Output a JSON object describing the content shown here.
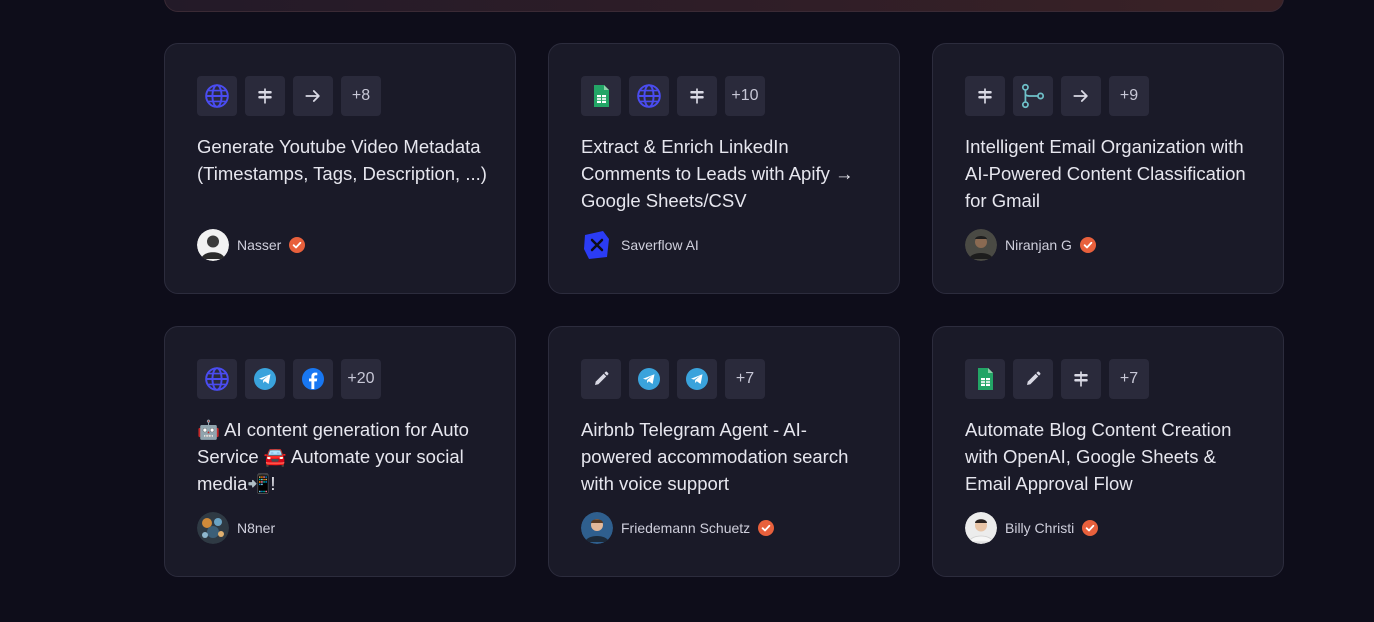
{
  "cards": [
    {
      "title": "Generate Youtube Video Metadata (Timestamps, Tags, Description, ...)",
      "more": "+8",
      "author": "Nasser",
      "verified": true
    },
    {
      "title": "Extract & Enrich LinkedIn Comments to Leads with Apify → Google Sheets/CSV",
      "more": "+10",
      "author": "Saverflow AI",
      "verified": false
    },
    {
      "title": "Intelligent Email Organization with AI-Powered Content Classification for Gmail",
      "more": "+9",
      "author": "Niranjan G",
      "verified": true
    },
    {
      "title": "🤖 AI content generation for Auto Service 🚘 Automate your social media📲!",
      "more": "+20",
      "author": "N8ner",
      "verified": false
    },
    {
      "title": "Airbnb Telegram Agent - AI-powered accommodation search with voice support",
      "more": "+7",
      "author": "Friedemann Schuetz",
      "verified": true
    },
    {
      "title": "Automate Blog Content Creation with OpenAI, Google Sheets & Email Approval Flow",
      "more": "+7",
      "author": "Billy Christi",
      "verified": true
    }
  ],
  "colors": {
    "background": "#0e0d1a",
    "card": "#1a1a28",
    "tile": "#2a2a3b",
    "verified": "#e8603c",
    "globe": "#4a4cf0",
    "telegram": "#3aa3dc",
    "facebook": "#1877f2",
    "sheets": "#23a566"
  },
  "icons": {
    "globe": "globe-icon",
    "signpost": "signpost-icon",
    "arrow": "arrow-right-icon",
    "sheets": "google-sheets-icon",
    "workflow": "workflow-nodes-icon",
    "telegram": "telegram-icon",
    "facebook": "facebook-icon",
    "pencil": "pencil-icon",
    "verified": "verified-badge-icon"
  }
}
